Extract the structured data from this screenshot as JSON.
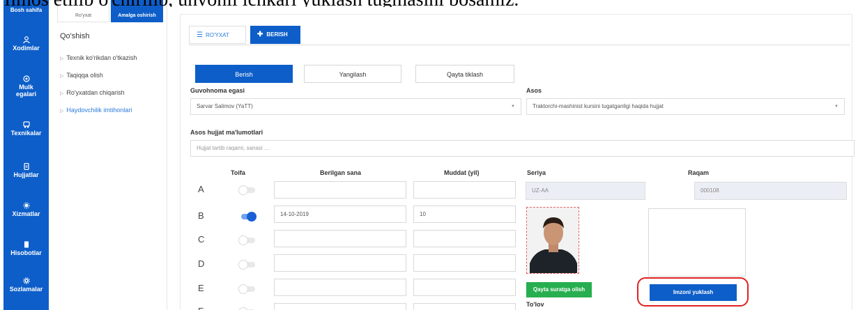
{
  "caption": "Ilmos etilib o'chirilib, unvonli ichkari yuklash tugmasini bosamiz.",
  "nav": {
    "top_label": "Bosh sahifa",
    "items": [
      {
        "label": "Xodimlar",
        "icon": "person-icon"
      },
      {
        "label": "Mulk egalari",
        "icon": "owner-icon"
      },
      {
        "label": "Texnikalar",
        "icon": "vehicle-icon"
      },
      {
        "label": "Hujjatlar",
        "icon": "document-icon"
      },
      {
        "label": "Xizmatlar",
        "icon": "services-icon"
      },
      {
        "label": "Hisobotlar",
        "icon": "report-icon"
      },
      {
        "label": "Sozlamalar",
        "icon": "gear-icon"
      }
    ]
  },
  "sub": {
    "tab_list": "Ro'yxat",
    "tab_actions": "Amalga oshirish",
    "title": "Qo'shish",
    "items": [
      "Texnik ko'rikdan o'tkazish",
      "Taqiqqa olish",
      "Ro'yxatdan chiqarish",
      "Haydovchilik imtihonlari"
    ],
    "active_index": 3
  },
  "main": {
    "tab_list": "RO'YXAT",
    "tab_give": "BERISH",
    "btn_give": "Berish",
    "btn_update": "Yangilash",
    "btn_restore": "Qayta tiklash",
    "owner_label": "Guvohnoma egasi",
    "owner_value": "Sarvar Salimov (YaTT)",
    "basis_label": "Asos",
    "basis_value": "Traktorchi-mashinist kursini tugatganligi haqida hujjat",
    "doc_label": "Asos hujjat ma'lumotlari",
    "doc_placeholder": "Hujjat tartib raqami, sanasi ...",
    "col_category": "Toifa",
    "col_date": "Berilgan sana",
    "col_term": "Muddat (yil)",
    "col_series": "Seriya",
    "col_number": "Raqam",
    "series_value": "UZ-AA",
    "number_value": "000108",
    "rows": [
      {
        "cat": "A",
        "on": false,
        "date": "",
        "term": ""
      },
      {
        "cat": "B",
        "on": true,
        "date": "14-10-2019",
        "term": "10"
      },
      {
        "cat": "C",
        "on": false,
        "date": "",
        "term": ""
      },
      {
        "cat": "D",
        "on": false,
        "date": "",
        "term": ""
      },
      {
        "cat": "E",
        "on": false,
        "date": "",
        "term": ""
      },
      {
        "cat": "F",
        "on": false,
        "date": "",
        "term": ""
      }
    ],
    "btn_retake_photo": "Qayta suratga olish",
    "btn_upload_signature": "Imzoni yuklash",
    "payment_label": "To'lov"
  }
}
